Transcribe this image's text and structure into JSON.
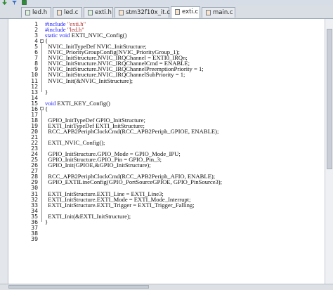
{
  "toolbar": {
    "icons": [
      "download-arrow-icon",
      "filter-icon",
      "chip-icon"
    ],
    "colors": {
      "download-arrow-icon": "#2a8a2a",
      "filter-icon": "#3a6fc4",
      "chip-icon": "#2f8a3a"
    }
  },
  "tabs": [
    {
      "label": "led.h",
      "type": "h",
      "active": false
    },
    {
      "label": "led.c",
      "type": "c",
      "active": false
    },
    {
      "label": "exti.h",
      "type": "h",
      "active": false
    },
    {
      "label": "stm32f10x_it.c",
      "type": "c",
      "active": false
    },
    {
      "label": "exti.c",
      "type": "c",
      "active": true
    },
    {
      "label": "main.c",
      "type": "c",
      "active": false
    }
  ],
  "editor": {
    "keyword_color": "#1a1aff",
    "string_color": "#b03030",
    "lines": [
      {
        "n": "1",
        "text": "#include \"exti.h\""
      },
      {
        "n": "2",
        "text": "#include \"led.h\""
      },
      {
        "n": "3",
        "text": "static void EXTI_NVIC_Config()"
      },
      {
        "n": "4",
        "text": "{"
      },
      {
        "n": "5",
        "text": "  NVIC_InitTypeDef NVIC_InitStructure;"
      },
      {
        "n": "6",
        "text": "  NVIC_PriorityGroupConfig(NVIC_PriorityGroup_1);"
      },
      {
        "n": "7",
        "text": "  NVIC_InitStructure.NVIC_IRQChannel = EXTI0_IRQn;"
      },
      {
        "n": "8",
        "text": "  NVIC_InitStructure.NVIC_IRQChannelCmd = ENABLE;"
      },
      {
        "n": "9",
        "text": "  NVIC_InitStructure.NVIC_IRQChannelPreemptionPriority = 1;"
      },
      {
        "n": "10",
        "text": "  NVIC_InitStructure.NVIC_IRQChannelSubPriority = 1;"
      },
      {
        "n": "11",
        "text": "  NVIC_Init(&NVIC_InitStructure);"
      },
      {
        "n": "12",
        "text": ""
      },
      {
        "n": "13",
        "text": "}"
      },
      {
        "n": "14",
        "text": ""
      },
      {
        "n": "15",
        "text": "void EXTI_KEY_Config()"
      },
      {
        "n": "16",
        "text": "{"
      },
      {
        "n": "17",
        "text": ""
      },
      {
        "n": "18",
        "text": "  GPIO_InitTypeDef GPIO_InitStructure;"
      },
      {
        "n": "19",
        "text": "  EXTI_InitTypeDef EXTI_InitStructure;"
      },
      {
        "n": "20",
        "text": "  RCC_APB2PeriphClockCmd(RCC_APB2Periph_GPIOE, ENABLE);"
      },
      {
        "n": "21",
        "text": ""
      },
      {
        "n": "22",
        "text": "  EXTI_NVIC_Config();"
      },
      {
        "n": "23",
        "text": ""
      },
      {
        "n": "24",
        "text": "  GPIO_InitStructure.GPIO_Mode = GPIO_Mode_IPU;"
      },
      {
        "n": "25",
        "text": "  GPIO_InitStructure.GPIO_Pin = GPIO_Pin_3;"
      },
      {
        "n": "26",
        "text": "  GPIO_Init(GPIOE,&GPIO_InitStructure);"
      },
      {
        "n": "27",
        "text": ""
      },
      {
        "n": "28",
        "text": "  RCC_APB2PeriphClockCmd(RCC_APB2Periph_AFIO, ENABLE);"
      },
      {
        "n": "29",
        "text": "  GPIO_EXTILineConfig(GPIO_PortSourceGPIOE, GPIO_PinSource3);"
      },
      {
        "n": "30",
        "text": ""
      },
      {
        "n": "31",
        "text": "  EXTI_InitStructure.EXTI_Line = EXTI_Line3;"
      },
      {
        "n": "32",
        "text": "  EXTI_InitStructure.EXTI_Mode = EXTI_Mode_Interrupt;"
      },
      {
        "n": "33",
        "text": "  EXTI_InitStructure.EXTI_Trigger = EXTI_Trigger_Falling;"
      },
      {
        "n": "34",
        "text": ""
      },
      {
        "n": "35",
        "text": "  EXTI_Init(&EXTI_InitStructure);"
      },
      {
        "n": "36",
        "text": "}"
      },
      {
        "n": "37",
        "text": ""
      },
      {
        "n": "38",
        "text": ""
      },
      {
        "n": "39",
        "text": ""
      }
    ]
  }
}
